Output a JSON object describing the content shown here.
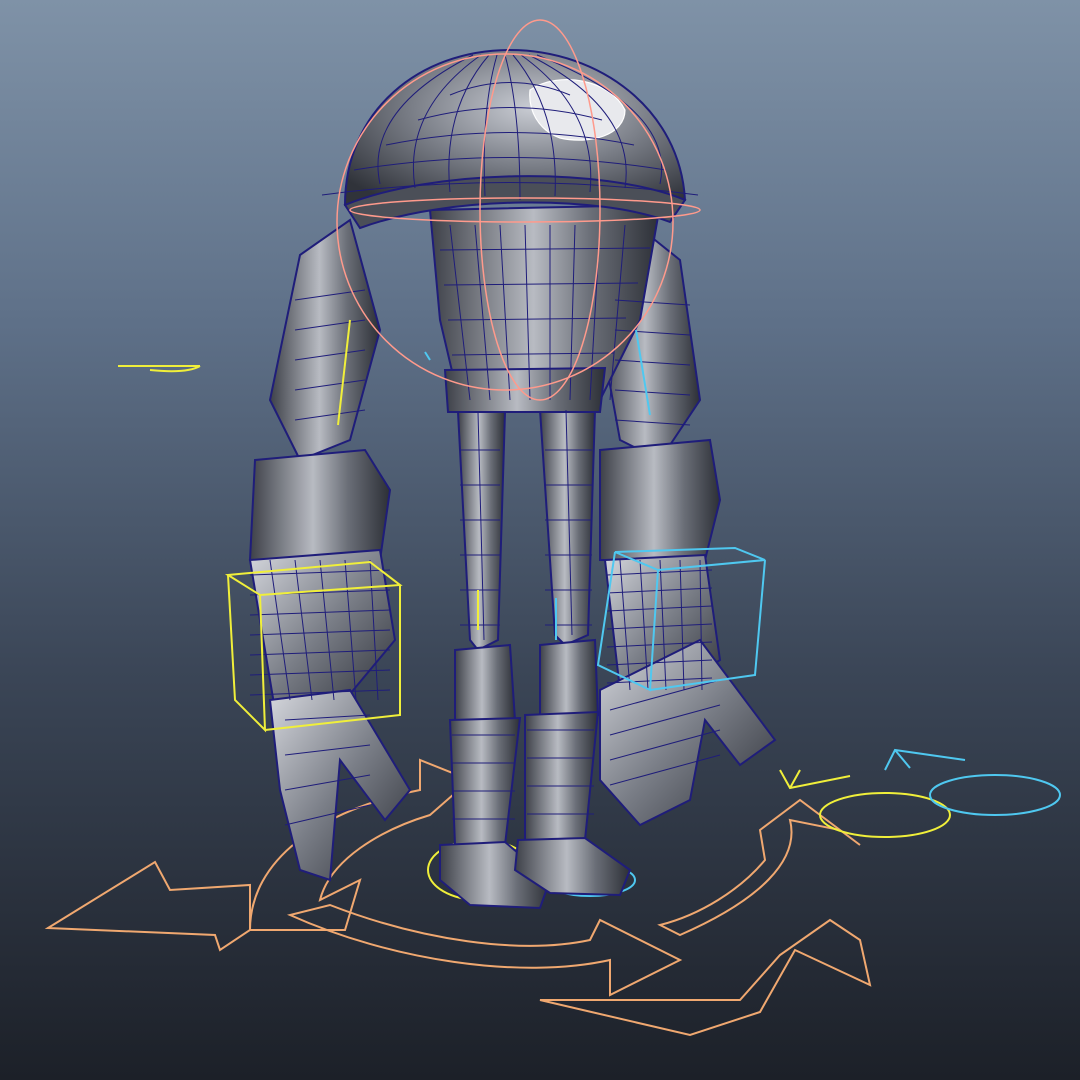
{
  "viewport": {
    "background_top": "#7f92a7",
    "background_bottom": "#1c2028"
  },
  "mesh": {
    "surface_color": "#6b6f78",
    "wireframe_color": "#1f1d7a",
    "selected_wire_color": "#ffffff"
  },
  "controls": {
    "head_sphere_color": "#ff9a8c",
    "global_move_color": "#f0a870",
    "left_side_color": "#f0ef3a",
    "right_side_color": "#4fc8f0",
    "center_color": "#ffb080"
  }
}
